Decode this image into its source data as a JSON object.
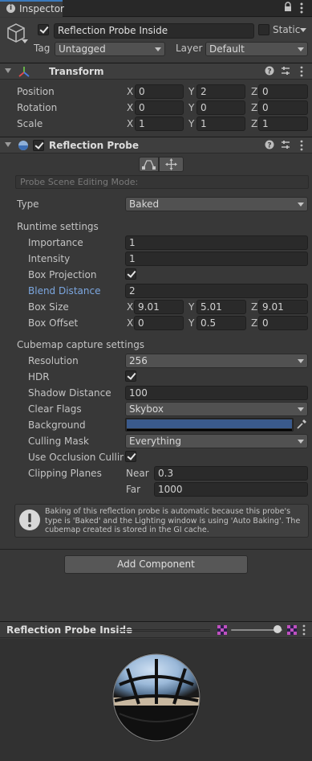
{
  "tab": {
    "label": "Inspector"
  },
  "object": {
    "name": "Reflection Probe Inside",
    "static_label": "Static",
    "tag_label": "Tag",
    "tag_value": "Untagged",
    "layer_label": "Layer",
    "layer_value": "Default"
  },
  "transform": {
    "title": "Transform",
    "rows": [
      {
        "label": "Position",
        "x": "0",
        "y": "2",
        "z": "0"
      },
      {
        "label": "Rotation",
        "x": "0",
        "y": "0",
        "z": "0"
      },
      {
        "label": "Scale",
        "x": "1",
        "y": "1",
        "z": "1"
      }
    ]
  },
  "axes": {
    "x": "X",
    "y": "Y",
    "z": "Z"
  },
  "probe": {
    "title": "Reflection Probe",
    "editing_mode": "Probe Scene Editing Mode:",
    "type_label": "Type",
    "type_value": "Baked",
    "runtime_header": "Runtime settings",
    "importance_label": "Importance",
    "importance_value": "1",
    "intensity_label": "Intensity",
    "intensity_value": "1",
    "box_projection_label": "Box Projection",
    "blend_distance_label": "Blend Distance",
    "blend_distance_value": "2",
    "box_size_label": "Box Size",
    "box_size": {
      "x": "9.01",
      "y": "5.01",
      "z": "9.01"
    },
    "box_offset_label": "Box Offset",
    "box_offset": {
      "x": "0",
      "y": "0.5",
      "z": "0"
    },
    "cubemap_header": "Cubemap capture settings",
    "resolution_label": "Resolution",
    "resolution_value": "256",
    "hdr_label": "HDR",
    "shadow_distance_label": "Shadow Distance",
    "shadow_distance_value": "100",
    "clear_flags_label": "Clear Flags",
    "clear_flags_value": "Skybox",
    "background_label": "Background",
    "background_color": "#3a5a8c",
    "culling_mask_label": "Culling Mask",
    "culling_mask_value": "Everything",
    "occlusion_label": "Use Occlusion Culling",
    "clipping_label": "Clipping Planes",
    "near_label": "Near",
    "near_value": "0.3",
    "far_label": "Far",
    "far_value": "1000",
    "info_text": "Baking of this reflection probe is automatic because this probe's type is 'Baked' and the Lighting window is using 'Auto Baking'. The cubemap created is stored in the GI cache."
  },
  "add_component_label": "Add Component",
  "preview": {
    "title": "Reflection Probe Inside"
  },
  "colors": {
    "accent_blue": "#7ca7e0",
    "panel": "#383838"
  }
}
